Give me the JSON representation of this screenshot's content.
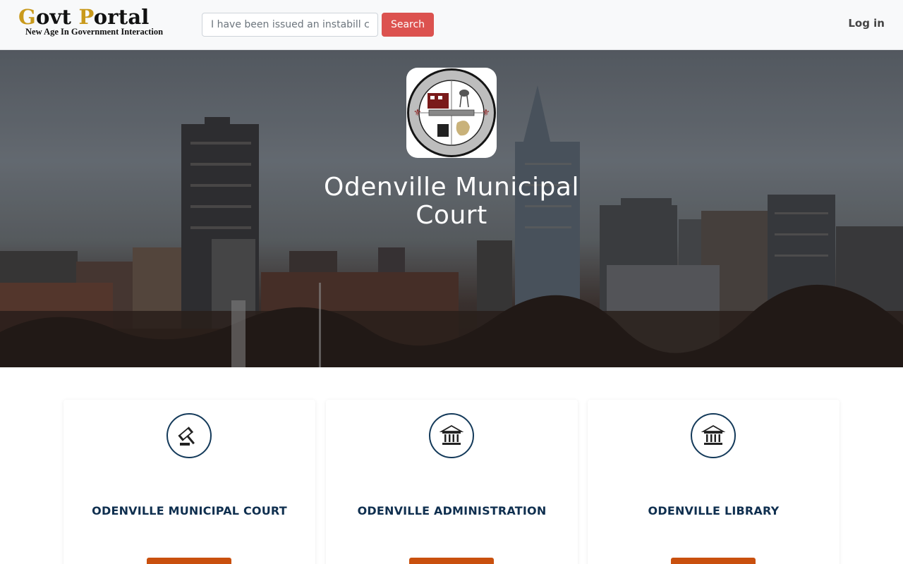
{
  "header": {
    "brand": {
      "title_first": "G",
      "title_mid": "ovt ",
      "title_second": "P",
      "title_rest": "ortal",
      "tagline": "New Age In Government Interaction"
    },
    "search": {
      "placeholder": "I have been issued an instabill citation",
      "button_label": "Search"
    },
    "login_label": "Log in"
  },
  "hero": {
    "title": "Odenville Municipal Court",
    "seal": {
      "top_text": "CITY OF ODENVILLE",
      "bottom_text": "INCORPORATED 1914"
    }
  },
  "cards": [
    {
      "title": "ODENVILLE MUNICIPAL COURT",
      "icon": "gavel-icon"
    },
    {
      "title": "ODENVILLE ADMINISTRATION",
      "icon": "government-building-icon"
    },
    {
      "title": "ODENVILLE LIBRARY",
      "icon": "library-building-icon"
    }
  ],
  "colors": {
    "accent_red": "#dc524f",
    "navy": "#0f2f4f",
    "orange_button": "#c9500e",
    "brand_gold": "#c99a1c"
  }
}
